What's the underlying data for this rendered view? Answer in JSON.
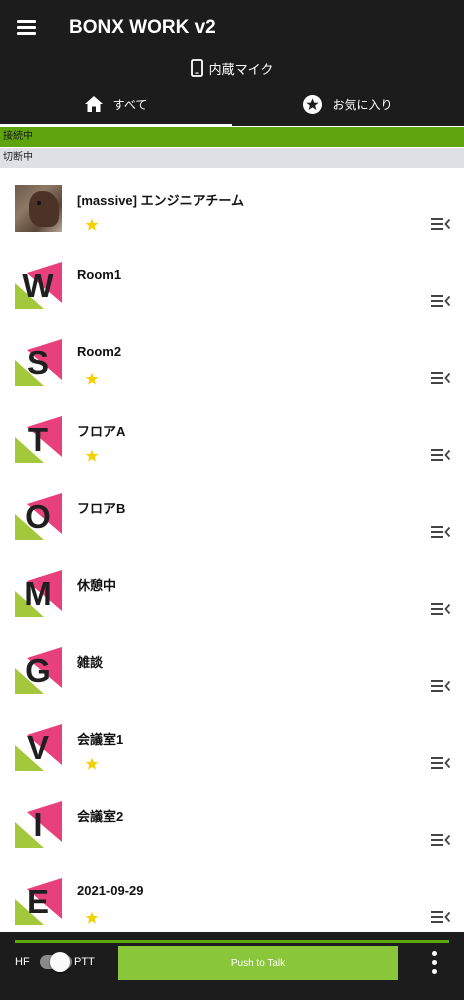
{
  "header": {
    "title": "BONX WORK v2",
    "menu_icon": "hamburger-menu-icon"
  },
  "audio_input": {
    "icon": "smartphone-icon",
    "label": "内蔵マイク"
  },
  "tabs": [
    {
      "icon": "home-icon",
      "label": "すべて",
      "selected": true
    },
    {
      "icon": "star-circle-icon",
      "label": "お気に入り",
      "selected": false
    }
  ],
  "sections": {
    "connected": "接続中",
    "disconnected": "切断中"
  },
  "rooms": [
    {
      "name": "[massive] エンジニアチーム",
      "avatar": "photo",
      "favorite": true
    },
    {
      "name": "Room1",
      "avatar": "W",
      "favorite": false
    },
    {
      "name": "Room2",
      "avatar": "S",
      "favorite": true
    },
    {
      "name": "フロアA",
      "avatar": "T",
      "favorite": true
    },
    {
      "name": "フロアB",
      "avatar": "O",
      "favorite": false
    },
    {
      "name": "休憩中",
      "avatar": "M",
      "favorite": false
    },
    {
      "name": "雑談",
      "avatar": "G",
      "favorite": false
    },
    {
      "name": "会議室1",
      "avatar": "V",
      "favorite": true
    },
    {
      "name": "会議室2",
      "avatar": "I",
      "favorite": false
    },
    {
      "name": "2021-09-29",
      "avatar": "E",
      "favorite": true
    }
  ],
  "bottom_bar": {
    "hf_label": "HF",
    "ptt_label": "PTT",
    "ptt_mode_on": true,
    "push_to_talk_label": "Push to Talk",
    "input_level": 1.0,
    "more_icon": "more-vertical-icon"
  },
  "colors": {
    "header_bg": "#1c1c1c",
    "connected_bar": "#5da40e",
    "disconnected_bar": "#dfe0e6",
    "ptt_button": "#8ac63a",
    "star": "#f5d000",
    "avatar_pink": "#e8407a",
    "avatar_green": "#a4c83c"
  }
}
